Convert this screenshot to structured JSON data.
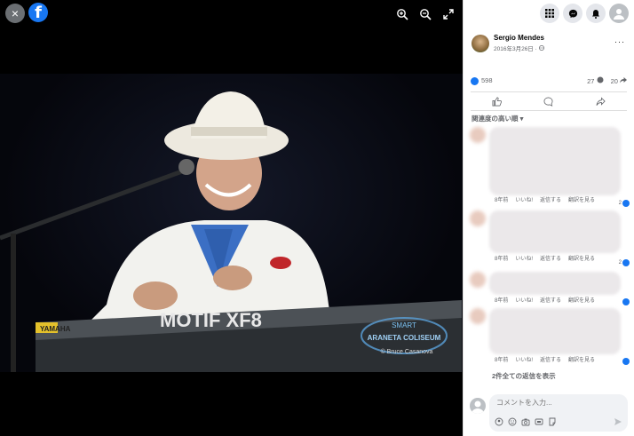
{
  "viewer": {
    "close_label": "×",
    "logo_text": "f",
    "watermark": {
      "venue_line1": "SMART",
      "venue_line2": "ARANETA COLISEUM",
      "credit": "© Bruce Casanova"
    },
    "keyboard_label": "MOTIF XF8",
    "keyboard_brand": "YAMAHA"
  },
  "post": {
    "author": "Sergio Mendes",
    "date": "2016年3月26日 · ",
    "more": "···",
    "likes": "598",
    "comments": "27",
    "shares": "20"
  },
  "sort_label": "関連度の高い順 ▾",
  "comments": [
    {
      "time": "8年前",
      "like": "いいね!",
      "reply": "返信する",
      "translate": "翻訳を見る",
      "reactions": "2"
    },
    {
      "time": "8年前",
      "like": "いいね!",
      "reply": "返信する",
      "translate": "翻訳を見る",
      "reactions": "2"
    },
    {
      "time": "8年前",
      "like": "いいね!",
      "reply": "返信する",
      "translate": "翻訳を見る",
      "reactions": ""
    },
    {
      "time": "8年前",
      "like": "いいね!",
      "reply": "返信する",
      "translate": "翻訳を見る",
      "reactions": ""
    }
  ],
  "show_replies": "2件全ての返信を表示",
  "composer": {
    "placeholder": "コメントを入力..."
  },
  "colors": {
    "brand": "#1877f2",
    "viewer_bg": "#000000"
  }
}
